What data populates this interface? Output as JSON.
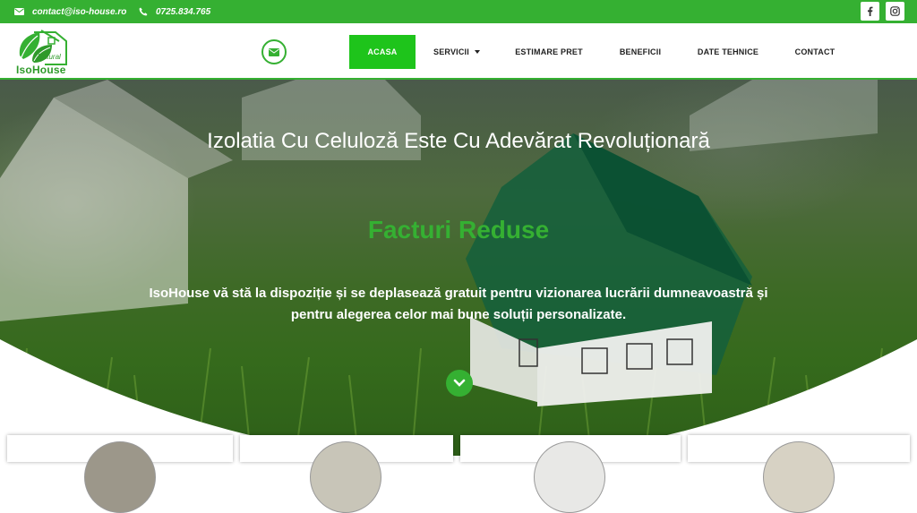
{
  "topbar": {
    "email": "contact@iso-house.ro",
    "phone": "0725.834.765",
    "icons": [
      "envelope-icon",
      "phone-icon",
      "facebook-icon",
      "instagram-icon"
    ]
  },
  "logo": {
    "name": "IsoHouse",
    "tag": "Natural"
  },
  "nav": {
    "items": [
      {
        "label": "ACASA",
        "active": true
      },
      {
        "label": "SERVICII",
        "dropdown": true
      },
      {
        "label": "ESTIMARE PRET"
      },
      {
        "label": "BENEFICII"
      },
      {
        "label": "DATE TEHNICE"
      },
      {
        "label": "CONTACT"
      }
    ]
  },
  "hero": {
    "title": "Izolatia Cu Celuloză Este Cu Adevărat Revoluționară",
    "subtitle": "Facturi Reduse",
    "brand": "IsoHouse",
    "text": " vă stă la dispoziție și se deplasează gratuit pentru vizionarea lucrării dumneavoastră și pentru alegerea celor mai bune soluții personalizate."
  },
  "colors": {
    "accent": "#35b032",
    "active_menu": "#1ec41b"
  }
}
